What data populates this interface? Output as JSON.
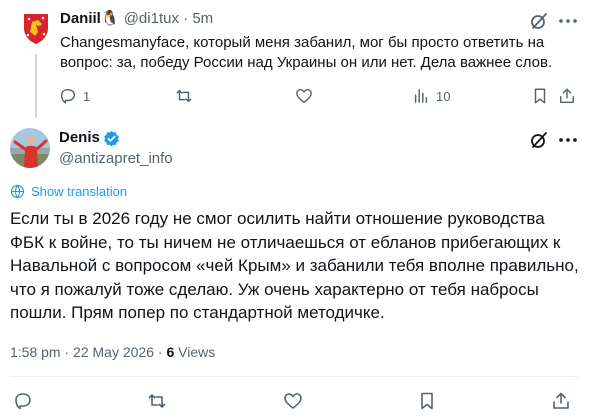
{
  "reply_tweet": {
    "display_name": "Daniil",
    "name_emoji": "🐧",
    "handle": "@di1tux",
    "separator": "·",
    "time": "5m",
    "text": "Changesmanyface, который меня забанил, мог бы просто ответить на вопрос: за, победу России над Украины он или нет. Дела важнее слов.",
    "actions": {
      "replies": "1",
      "views": "10"
    }
  },
  "main_tweet": {
    "display_name": "Denis",
    "handle": "@antizapret_info",
    "show_translation": "Show translation",
    "text": "Если ты в 2026 году не смог осилить найти отношение руководства ФБК к войне, то ты ничем не отличаешься от ебланов прибегающих к Навальной с вопросом «чей Крым» и забанили тебя вполне правильно, что я пожалуй тоже сделаю. Уж очень характерно от тебя набросы пошли. Прям попер по стандартной методичке.",
    "time": "1:58 pm",
    "dot": "·",
    "date": "22 May 2026",
    "views_count": "6",
    "views_label": "Views"
  },
  "colors": {
    "accent": "#1d9bf0",
    "text": "#0f1419",
    "muted": "#536471",
    "divider": "#eff3f4",
    "verified": "#1d9bf0",
    "coat_of_arms_red": "#d8242c",
    "coat_of_arms_gold": "#f2c21b"
  },
  "icons": {
    "reply": "reply-icon",
    "repost": "repost-icon",
    "like": "heart-icon",
    "views": "views-icon",
    "bookmark": "bookmark-icon",
    "share": "share-icon",
    "grok": "grok-icon",
    "more": "more-icon",
    "verified": "verified-badge-icon",
    "translate": "globe-icon"
  }
}
